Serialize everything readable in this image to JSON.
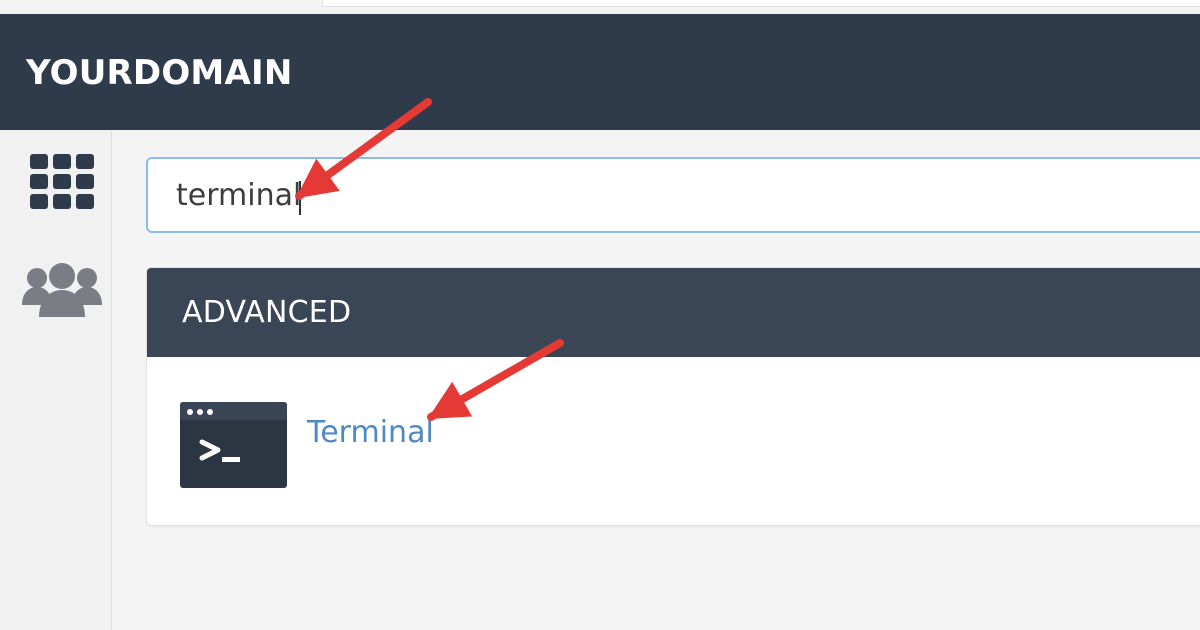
{
  "header": {
    "brand": "YOURDOMAIN"
  },
  "sidebar": {
    "items": [
      {
        "icon": "grid-icon",
        "label": ""
      },
      {
        "icon": "users-icon",
        "label": ""
      }
    ]
  },
  "search": {
    "value": "terminal",
    "placeholder": ""
  },
  "results": {
    "group_title": "ADVANCED",
    "items": [
      {
        "label": "Terminal",
        "icon": "terminal-icon"
      }
    ]
  },
  "colors": {
    "header_bg": "#2f3a4a",
    "panel_header_bg": "#3a4555",
    "link": "#4f89c2",
    "focus_border": "#8cbcef",
    "arrow": "#e53935"
  }
}
